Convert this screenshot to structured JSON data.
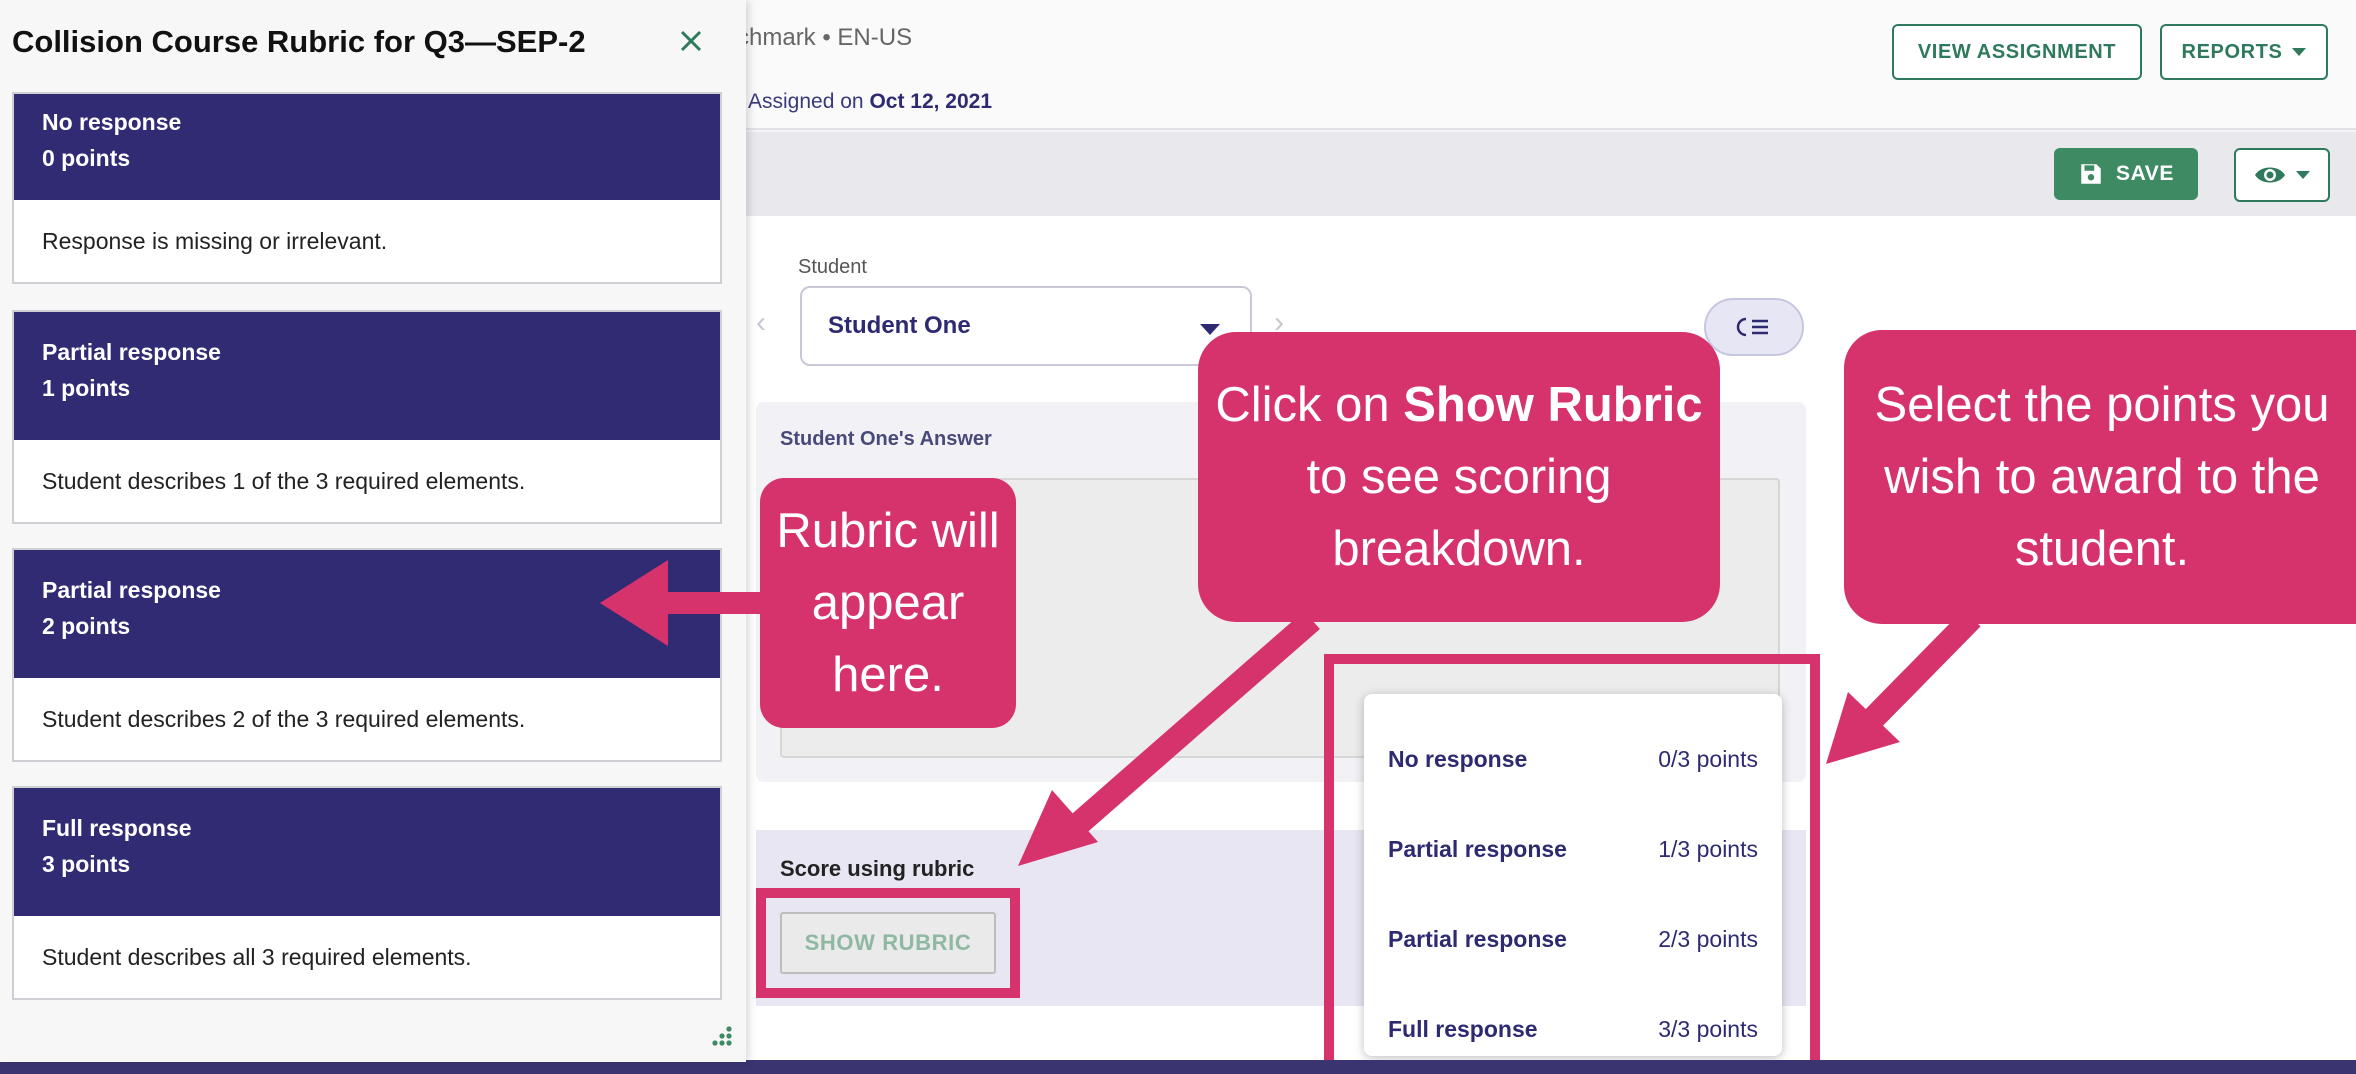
{
  "header": {
    "meta_text": "chmark • EN-US",
    "assigned_prefix": "Assigned on",
    "assigned_date": "Oct 12, 2021",
    "view_assignment_label": "VIEW ASSIGNMENT",
    "reports_label": "REPORTS"
  },
  "toolbar": {
    "save_label": "SAVE",
    "visibility_icon": "eye-icon"
  },
  "student": {
    "label": "Student",
    "selected": "Student One"
  },
  "answer": {
    "label": "Student One's Answer",
    "content": ""
  },
  "score": {
    "label": "Score using rubric",
    "show_rubric_label": "SHOW RUBRIC",
    "options": [
      {
        "name": "No response",
        "points": "0/3 points"
      },
      {
        "name": "Partial response",
        "points": "1/3 points"
      },
      {
        "name": "Partial response",
        "points": "2/3 points"
      },
      {
        "name": "Full response",
        "points": "3/3 points"
      }
    ]
  },
  "rubric_panel": {
    "title": "Collision Course Rubric for Q3—SEP-2",
    "levels": [
      {
        "name": "No response",
        "points": "0 points",
        "description": "Response is missing or irrelevant."
      },
      {
        "name": "Partial response",
        "points": "1 points",
        "description": "Student describes 1 of the 3 required elements."
      },
      {
        "name": "Partial response",
        "points": "2 points",
        "description": "Student describes 2 of the 3 required elements."
      },
      {
        "name": "Full response",
        "points": "3 points",
        "description": "Student describes all 3 required elements."
      }
    ]
  },
  "callouts": {
    "rubric_appear": "Rubric will appear here.",
    "show_rubric_prefix": "Click on",
    "show_rubric_bold": "Show Rubric",
    "show_rubric_suffix": "to see scoring breakdown.",
    "select_points": "Select the points you wish to award to the student."
  },
  "colors": {
    "brand_green": "#3d8a63",
    "rubric_header": "#312b74",
    "callout": "#d6336c"
  }
}
